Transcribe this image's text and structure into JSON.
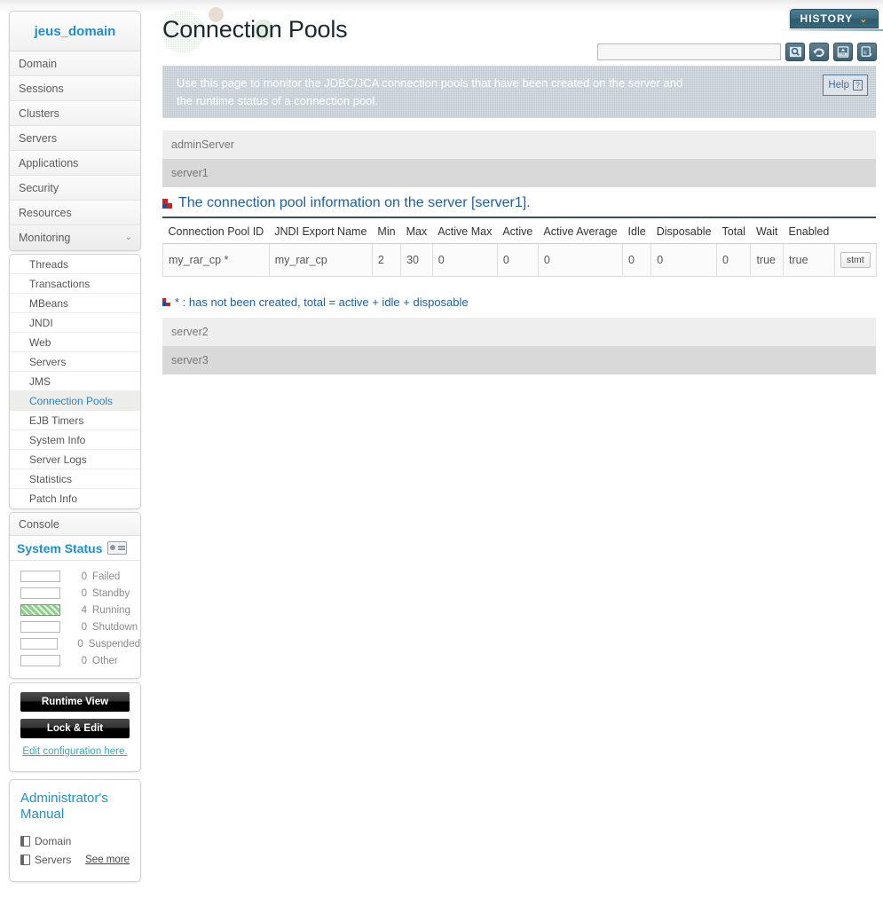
{
  "sidebar": {
    "domain_title": "jeus_domain",
    "nav": [
      {
        "label": "Domain",
        "expandable": false
      },
      {
        "label": "Sessions",
        "expandable": false
      },
      {
        "label": "Clusters",
        "expandable": false
      },
      {
        "label": "Servers",
        "expandable": false
      },
      {
        "label": "Applications",
        "expandable": false
      },
      {
        "label": "Security",
        "expandable": false
      },
      {
        "label": "Resources",
        "expandable": false
      },
      {
        "label": "Monitoring",
        "expandable": true,
        "chevron": "⌄"
      }
    ],
    "submenu": [
      {
        "label": "Threads",
        "selected": false
      },
      {
        "label": "Transactions",
        "selected": false
      },
      {
        "label": "MBeans",
        "selected": false
      },
      {
        "label": "JNDI",
        "selected": false
      },
      {
        "label": "Web",
        "selected": false
      },
      {
        "label": "Servers",
        "selected": false
      },
      {
        "label": "JMS",
        "selected": false
      },
      {
        "label": "Connection Pools",
        "selected": true
      },
      {
        "label": "EJB Timers",
        "selected": false
      },
      {
        "label": "System Info",
        "selected": false
      },
      {
        "label": "Server Logs",
        "selected": false
      },
      {
        "label": "Statistics",
        "selected": false
      },
      {
        "label": "Patch Info",
        "selected": false
      }
    ],
    "console_label": "Console",
    "system_status": {
      "title": "System Status",
      "rows": [
        {
          "count": "0",
          "label": "Failed",
          "filled": false
        },
        {
          "count": "0",
          "label": "Standby",
          "filled": false
        },
        {
          "count": "4",
          "label": "Running",
          "filled": true
        },
        {
          "count": "0",
          "label": "Shutdown",
          "filled": false
        },
        {
          "count": "0",
          "label": "Suspended",
          "filled": false
        },
        {
          "count": "0",
          "label": "Other",
          "filled": false
        }
      ],
      "filled_color": "#8fce8b"
    },
    "runtime_view_label": "Runtime View",
    "lock_edit_label": "Lock & Edit",
    "edit_config_label": "Edit configuration here.",
    "manual": {
      "title": "Administrator's Manual",
      "links": [
        "Domain",
        "Servers"
      ],
      "see_more": "See more"
    }
  },
  "header": {
    "title": "Connection Pools",
    "history_label": "HISTORY",
    "history_caret": "⌄",
    "search_value": "",
    "search_placeholder": "",
    "tools": [
      "search-icon",
      "refresh-icon",
      "export-xml-icon",
      "export-excel-icon"
    ]
  },
  "banner": {
    "line1": "Use this page to monitor the JDBC/JCA connection pools that have been created on the server and",
    "line2": "the runtime status of a connection pool.",
    "help_label": "Help",
    "help_mark": "?"
  },
  "servers_top": [
    "adminServer",
    "server1"
  ],
  "servers_bottom": [
    "server2",
    "server3"
  ],
  "section": {
    "heading": "The connection pool information on the server [server1]."
  },
  "table": {
    "columns": [
      "Connection Pool ID",
      "JNDI Export Name",
      "Min",
      "Max",
      "Active Max",
      "Active",
      "Active Average",
      "Idle",
      "Disposable",
      "Total",
      "Wait",
      "Enabled",
      ""
    ],
    "rows": [
      {
        "cells": [
          "my_rar_cp *",
          "my_rar_cp",
          "2",
          "30",
          "0",
          "0",
          "0",
          "0",
          "0",
          "0",
          "true",
          "true"
        ],
        "action_label": "stmt"
      }
    ]
  },
  "footnote": {
    "text": "* : has not been created, total = active + idle + disposable"
  },
  "colors": {
    "accent_blue": "#1b8fd4",
    "link_blue": "#1b5fa8",
    "banner_bg": "#b9c3ca",
    "history_teal": "#3c6c80",
    "caret_orange": "#f5a623"
  }
}
